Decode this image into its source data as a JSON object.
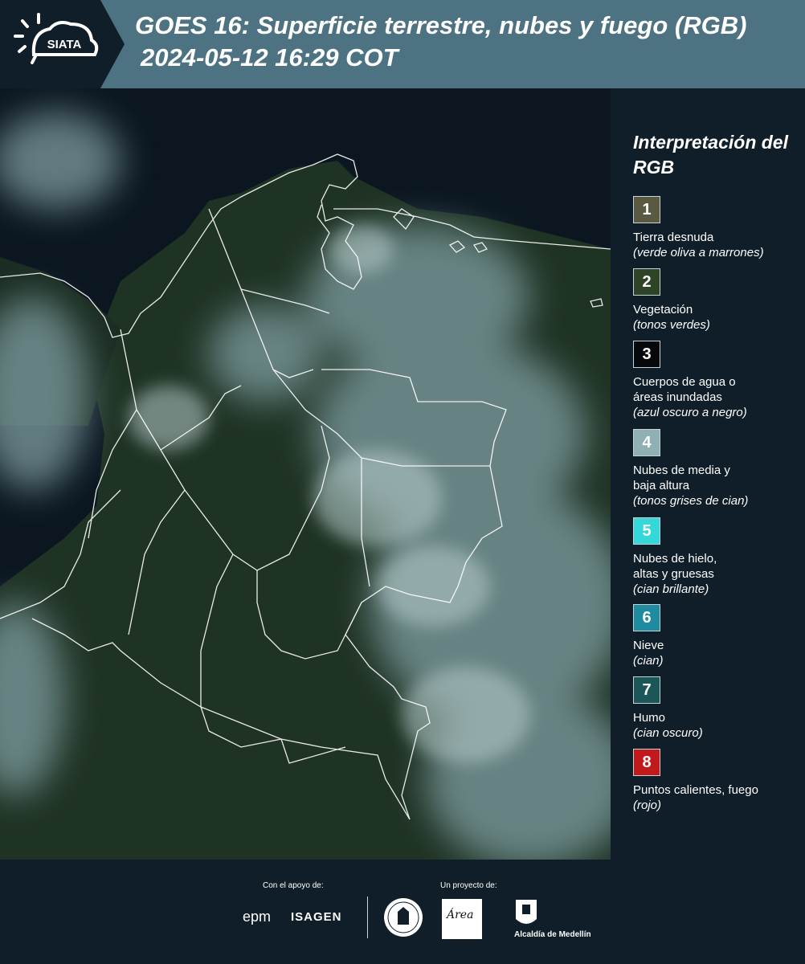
{
  "header": {
    "logo_text": "SIATA",
    "title_line1": "GOES 16: Superficie terrestre, nubes y fuego (RGB)",
    "title_line2": "2024-05-12 16:29 COT"
  },
  "legend": {
    "title": "Interpretación del RGB",
    "items": [
      {
        "number": "1",
        "label": "Tierra desnuda",
        "description": "(verde oliva a marrones)",
        "color": "#5a5a42"
      },
      {
        "number": "2",
        "label": "Vegetación",
        "description": "(tonos verdes)",
        "color": "#2d4426"
      },
      {
        "number": "3",
        "label": "Cuerpos de agua o\náreas inundadas",
        "description": "(azul oscuro a negro)",
        "color": "#05090c"
      },
      {
        "number": "4",
        "label": "Nubes de media y\nbaja altura",
        "description": "(tonos grises de cian)",
        "color": "#8fb1b3"
      },
      {
        "number": "5",
        "label": "Nubes de hielo,\naltas y gruesas",
        "description": "(cian brillante)",
        "color": "#35d8d8"
      },
      {
        "number": "6",
        "label": "Nieve",
        "description": "(cian)",
        "color": "#1f8ba0"
      },
      {
        "number": "7",
        "label": "Humo",
        "description": "(cian oscuro)",
        "color": "#1c5659"
      },
      {
        "number": "8",
        "label": "Puntos calientes, fuego",
        "description": "(rojo)",
        "color": "#c1191c"
      }
    ]
  },
  "footer": {
    "support_label": "Con el apoyo de:",
    "project_label": "Un proyecto de:",
    "epm": "epm",
    "isagen": "ISAGEN",
    "area": "Área",
    "alcaldia": "Alcaldía de Medellín"
  }
}
